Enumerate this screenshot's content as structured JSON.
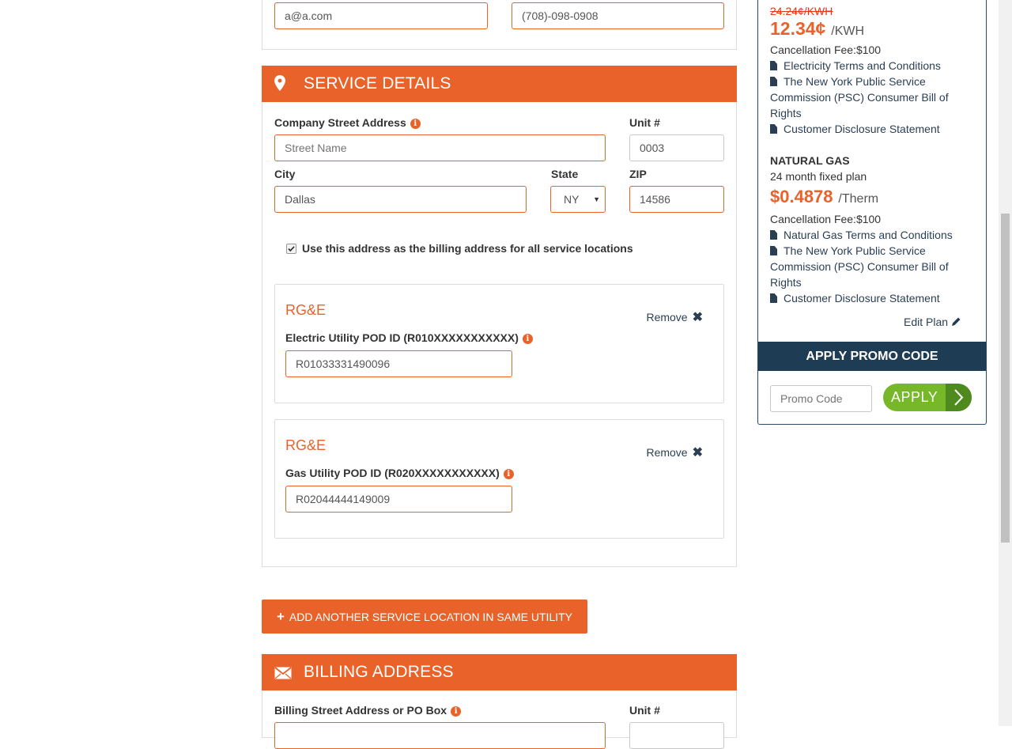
{
  "contact": {
    "email_value": "a@a.com",
    "phone_value": "(708)-098-0908"
  },
  "service_details": {
    "header": "SERVICE DETAILS",
    "street_label": "Company Street Address",
    "street_placeholder": "Street Name",
    "unit_label": "Unit #",
    "unit_value": "0003",
    "city_label": "City",
    "city_value": "Dallas",
    "state_label": "State",
    "state_value": "NY",
    "zip_label": "ZIP",
    "zip_value": "14586",
    "billing_checkbox_label": "Use this address as the billing address for all service locations",
    "billing_checkbox_checked": true
  },
  "utilities": [
    {
      "name": "RG&E",
      "remove_label": "Remove",
      "pod_label": "Electric Utility POD ID (R010XXXXXXXXXXX)",
      "pod_value": "R01033331490096"
    },
    {
      "name": "RG&E",
      "remove_label": "Remove",
      "pod_label": "Gas Utility POD ID (R020XXXXXXXXXXX)",
      "pod_value": "R02044444149009"
    }
  ],
  "add_location_label": "ADD ANOTHER SERVICE LOCATION IN SAME UTILITY",
  "billing_address": {
    "header": "BILLING ADDRESS",
    "street_label": "Billing Street Address or PO Box",
    "unit_label": "Unit #"
  },
  "sidebar": {
    "electric": {
      "old_rate": "24.24¢/KWH",
      "rate": "12.34¢",
      "rate_unit": "/KWH",
      "cancellation": "Cancellation Fee:$100",
      "links": [
        "Electricity Terms and Conditions",
        "The New York Public Service Commission (PSC) Consumer Bill of Rights",
        "Customer Disclosure Statement"
      ]
    },
    "gas": {
      "title": "NATURAL GAS",
      "plan": "24 month fixed plan",
      "rate": "$0.4878",
      "rate_unit": "/Therm",
      "cancellation": "Cancellation Fee:$100",
      "links": [
        "Natural Gas Terms and Conditions",
        "The New York Public Service Commission (PSC) Consumer Bill of Rights",
        "Customer Disclosure Statement"
      ]
    },
    "edit_plan_label": "Edit Plan",
    "promo_header": "APPLY PROMO CODE",
    "promo_placeholder": "Promo Code",
    "apply_label": "APPLY"
  },
  "colors": {
    "accent": "#e8622a",
    "navy": "#1f3c55",
    "green": "#76b82a",
    "dark_green": "#4e8a1e"
  }
}
